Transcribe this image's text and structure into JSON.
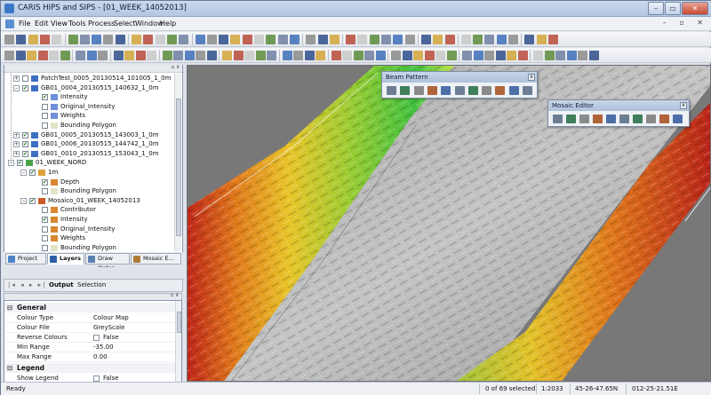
{
  "window": {
    "title": "CARIS HIPS and SIPS - [01_WEEK_14052013]",
    "controls": [
      "–",
      "▭",
      "✕"
    ]
  },
  "menu": [
    "File",
    "Edit",
    "View",
    "Tools",
    "Process",
    "Select",
    "Window",
    "Help"
  ],
  "menu_doc_controls": "– ▫ ✕",
  "layers_tree": [
    {
      "label": "PatchTest_0005_20130514_101005_1_0m",
      "checked": false,
      "expand": "+",
      "icon": "track-lines-icon"
    },
    {
      "label": "GB01_0004_20130515_140632_1_0m",
      "checked": true,
      "expand": "–",
      "icon": "track-lines-icon"
    },
    {
      "label": "Intensity",
      "checked": true,
      "expand": "",
      "icon": "surface-layer-icon"
    },
    {
      "label": "Original_Intensity",
      "checked": false,
      "expand": "",
      "icon": "surface-layer-icon"
    },
    {
      "label": "Weights",
      "checked": false,
      "expand": "",
      "icon": "surface-layer-icon"
    },
    {
      "label": "Bounding Polygon",
      "checked": false,
      "expand": "",
      "icon": "polygon-icon"
    },
    {
      "label": "GB01_0005_20130515_143003_1_0m",
      "checked": true,
      "expand": "+",
      "icon": "track-lines-icon"
    },
    {
      "label": "GB01_0006_20130515_144742_1_0m",
      "checked": true,
      "expand": "+",
      "icon": "track-lines-icon"
    },
    {
      "label": "GB01_0010_20130515_153043_1_0m",
      "checked": true,
      "expand": "+",
      "icon": "track-lines-icon"
    },
    {
      "label": "01_WEEK_NORD",
      "checked": true,
      "expand": "–",
      "icon": "field-sheet-icon"
    },
    {
      "label": "1m",
      "checked": true,
      "expand": "–",
      "icon": "grid-surface-icon"
    },
    {
      "label": "Depth",
      "checked": true,
      "expand": "",
      "icon": "depth-layer-icon"
    },
    {
      "label": "Bounding Polygon",
      "checked": false,
      "expand": "",
      "icon": "polygon-icon"
    },
    {
      "label": "Mosaico_01_WEEK_14052013",
      "checked": true,
      "expand": "–",
      "icon": "mosaic-icon"
    },
    {
      "label": "Contributor",
      "checked": false,
      "expand": "",
      "icon": "depth-layer-icon"
    },
    {
      "label": "Intensity",
      "checked": true,
      "expand": "",
      "icon": "depth-layer-icon"
    },
    {
      "label": "Original_Intensity",
      "checked": false,
      "expand": "",
      "icon": "depth-layer-icon"
    },
    {
      "label": "Weights",
      "checked": false,
      "expand": "",
      "icon": "depth-layer-icon"
    },
    {
      "label": "Bounding Polygon",
      "checked": false,
      "expand": "",
      "icon": "polygon-icon"
    }
  ],
  "panel_tabs": [
    "Project",
    "Layers",
    "Draw Order",
    "Mosaic E..."
  ],
  "output_tabs": [
    "Output",
    "Selection"
  ],
  "properties": {
    "general_title": "General",
    "rows": [
      {
        "name": "Colour Type",
        "value": "Colour Map"
      },
      {
        "name": "Colour File",
        "value": "GreyScale"
      },
      {
        "name": "Reverse Colours",
        "value": "False"
      },
      {
        "name": "Min Range",
        "value": "-35.00"
      },
      {
        "name": "Max Range",
        "value": "0.00"
      }
    ],
    "legend_title": "Legend",
    "legend_rows": [
      {
        "name": "Show Legend",
        "value": "False"
      }
    ]
  },
  "beam_pattern": {
    "title": "Beam Pattern",
    "close": "x"
  },
  "mosaic_editor": {
    "title": "Mosaic Editor",
    "close": "x"
  },
  "status": {
    "state": "Ready",
    "selected": "0 of 69 selected",
    "scale": "1:2033",
    "lat": "45-26-47.65N",
    "lon": "012-25-21.51E"
  },
  "colors": {
    "title_bar": "#b9cbe3",
    "map_background": "#777777",
    "selected_tab": "#ffffff"
  }
}
